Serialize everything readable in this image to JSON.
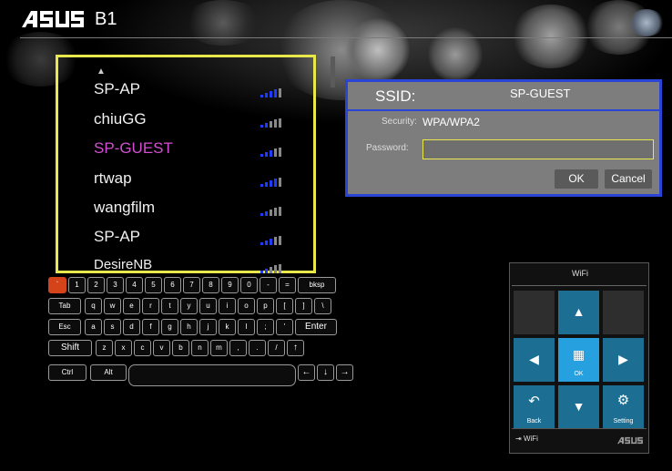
{
  "header": {
    "brand": "ASUS",
    "model": "B1"
  },
  "wifi_list": {
    "networks": [
      {
        "name": "SP-AP",
        "signal": 4,
        "selected": false
      },
      {
        "name": "chiuGG",
        "signal": 2,
        "selected": false
      },
      {
        "name": "SP-GUEST",
        "signal": 3,
        "selected": true
      },
      {
        "name": "rtwap",
        "signal": 4,
        "selected": false
      },
      {
        "name": "wangfilm",
        "signal": 2,
        "selected": false
      },
      {
        "name": "SP-AP",
        "signal": 3,
        "selected": false
      },
      {
        "name": "DesireNB",
        "signal": 2,
        "selected": false
      }
    ]
  },
  "dialog": {
    "ssid_label": "SSID:",
    "ssid_value": "SP-GUEST",
    "security_label": "Security:",
    "security_value": "WPA/WPA2",
    "password_label": "Password:",
    "password_value": "",
    "ok_label": "OK",
    "cancel_label": "Cancel"
  },
  "keyboard": {
    "row1": [
      "`",
      "1",
      "2",
      "3",
      "4",
      "5",
      "6",
      "7",
      "8",
      "9",
      "0",
      "-",
      "=",
      "bksp"
    ],
    "row2": [
      "Tab",
      "q",
      "w",
      "e",
      "r",
      "t",
      "y",
      "u",
      "i",
      "o",
      "p",
      "[",
      "]",
      "\\"
    ],
    "row3": [
      "Esc",
      "a",
      "s",
      "d",
      "f",
      "g",
      "h",
      "j",
      "k",
      "l",
      ";",
      "'",
      "Enter"
    ],
    "row4": [
      "Shift",
      "z",
      "x",
      "c",
      "v",
      "b",
      "n",
      "m",
      ",",
      ".",
      "/",
      "↑"
    ],
    "row5": [
      "Ctrl",
      "Alt",
      "",
      "←",
      "↓",
      "→"
    ]
  },
  "remote": {
    "title": "WiFi",
    "ok_label": "OK",
    "back_label": "Back",
    "setting_label": "Setting",
    "footer_label": "WiFi",
    "footer_brand": "ASUS"
  },
  "colors": {
    "selection_border": "#e8e84b",
    "dialog_border": "#2a45d6",
    "selected_network": "#d24fd2",
    "highlight_key": "#d4431a",
    "remote_blue": "#1c6e93",
    "remote_focus": "#27a0e0"
  }
}
